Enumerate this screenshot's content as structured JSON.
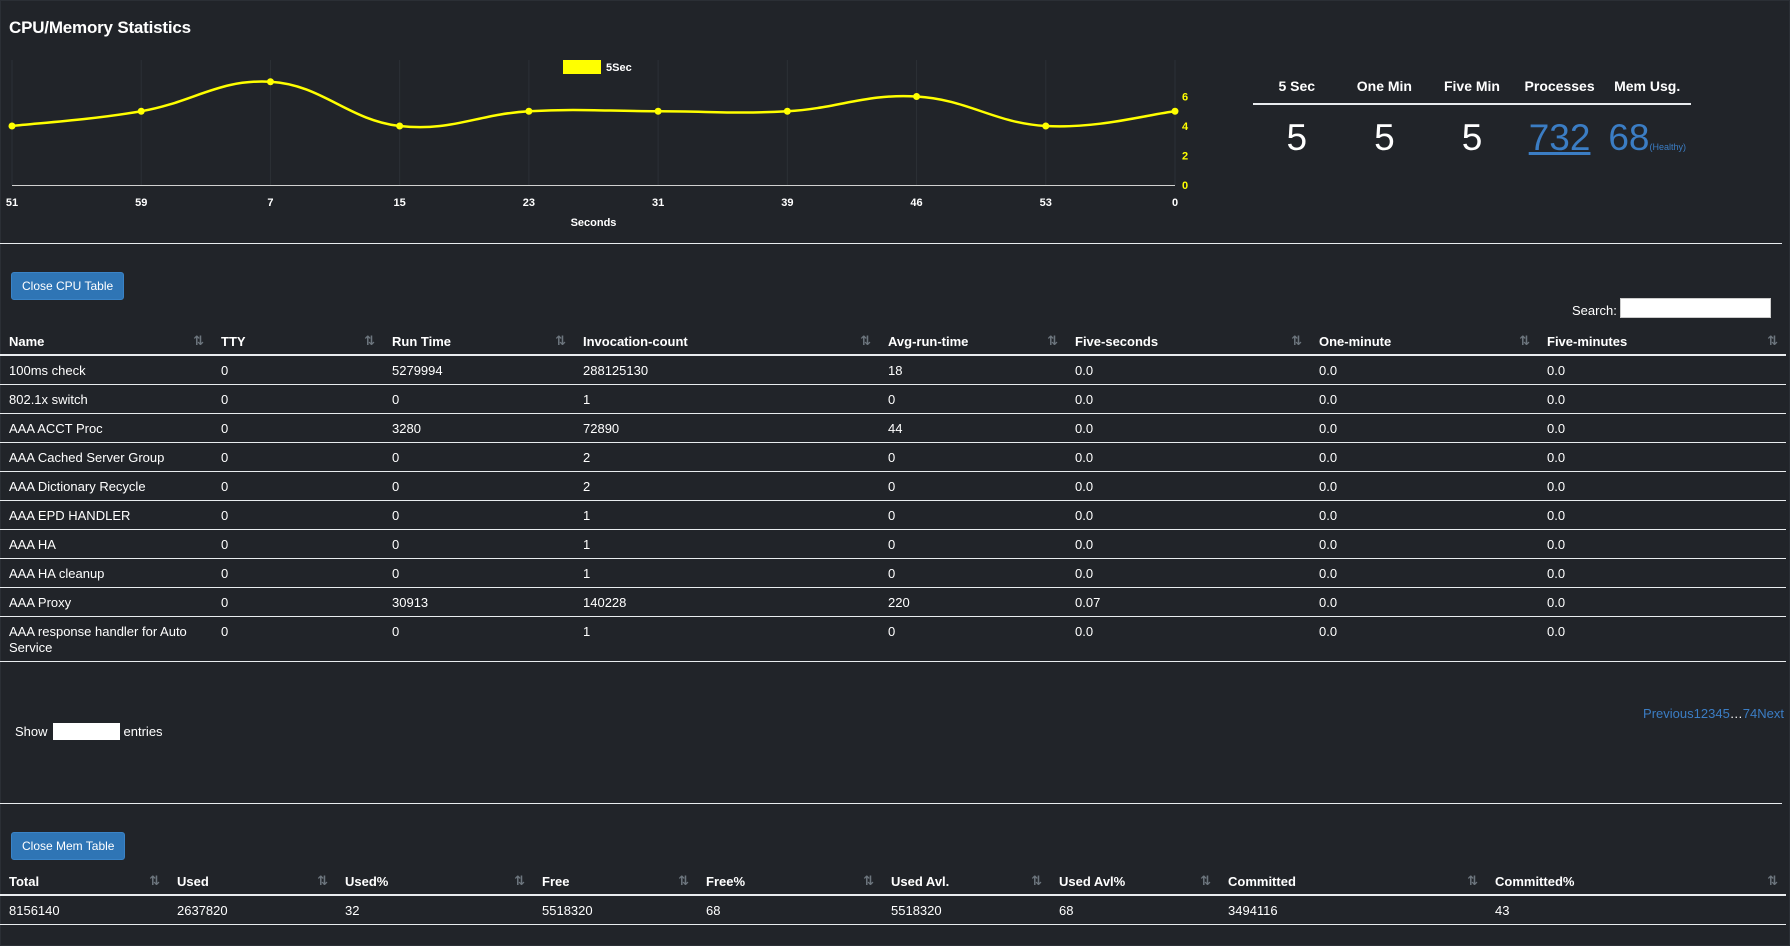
{
  "title": "CPU/Memory Statistics",
  "chart_data": {
    "type": "line",
    "series": [
      {
        "name": "5Sec",
        "color": "#ffff00",
        "values": [
          4,
          5,
          7,
          4,
          5,
          5,
          5,
          6,
          4,
          5
        ]
      }
    ],
    "categories": [
      "51",
      "59",
      "7",
      "15",
      "23",
      "31",
      "39",
      "46",
      "53",
      "0"
    ],
    "xlabel": "Seconds",
    "ylabel": "",
    "yticks": [
      "0",
      "2",
      "4",
      "6"
    ],
    "ylim": [
      0,
      8
    ],
    "legend_position": "top-center",
    "grid": true
  },
  "stats": {
    "headers": [
      "5 Sec",
      "One Min",
      "Five Min",
      "Processes",
      "Mem Usg."
    ],
    "five_sec": "5",
    "one_min": "5",
    "five_min": "5",
    "processes": "732",
    "mem_usage": "68",
    "mem_status": "(Healthy)"
  },
  "cpu_table": {
    "close_label": "Close CPU Table",
    "search_label": "Search:",
    "sort_icon": "sort-icon",
    "columns": [
      "Name",
      "TTY",
      "Run Time",
      "Invocation-count",
      "Avg-run-time",
      "Five-seconds",
      "One-minute",
      "Five-minutes"
    ],
    "rows": [
      [
        "100ms check",
        "0",
        "5279994",
        "288125130",
        "18",
        "0.0",
        "0.0",
        "0.0"
      ],
      [
        "802.1x switch",
        "0",
        "0",
        "1",
        "0",
        "0.0",
        "0.0",
        "0.0"
      ],
      [
        "AAA ACCT Proc",
        "0",
        "3280",
        "72890",
        "44",
        "0.0",
        "0.0",
        "0.0"
      ],
      [
        "AAA Cached Server Group",
        "0",
        "0",
        "2",
        "0",
        "0.0",
        "0.0",
        "0.0"
      ],
      [
        "AAA Dictionary Recycle",
        "0",
        "0",
        "2",
        "0",
        "0.0",
        "0.0",
        "0.0"
      ],
      [
        "AAA EPD HANDLER",
        "0",
        "0",
        "1",
        "0",
        "0.0",
        "0.0",
        "0.0"
      ],
      [
        "AAA HA",
        "0",
        "0",
        "1",
        "0",
        "0.0",
        "0.0",
        "0.0"
      ],
      [
        "AAA HA cleanup",
        "0",
        "0",
        "1",
        "0",
        "0.0",
        "0.0",
        "0.0"
      ],
      [
        "AAA Proxy",
        "0",
        "30913",
        "140228",
        "220",
        "0.07",
        "0.0",
        "0.0"
      ],
      [
        "AAA response handler for Auto Service",
        "0",
        "0",
        "1",
        "0",
        "0.0",
        "0.0",
        "0.0"
      ]
    ],
    "show_label": "Show",
    "entries_label": "entries",
    "pagination": {
      "previous": "Previous",
      "pages": [
        "1",
        "2",
        "3",
        "4",
        "5"
      ],
      "ellipsis": "…",
      "last": "74",
      "next": "Next"
    }
  },
  "mem_table": {
    "close_label": "Close Mem Table",
    "columns": [
      "Total",
      "Used",
      "Used%",
      "Free",
      "Free%",
      "Used Avl.",
      "Used Avl%",
      "Committed",
      "Committed%"
    ],
    "rows": [
      [
        "8156140",
        "2637820",
        "32",
        "5518320",
        "68",
        "5518320",
        "68",
        "3494116",
        "43"
      ]
    ]
  }
}
